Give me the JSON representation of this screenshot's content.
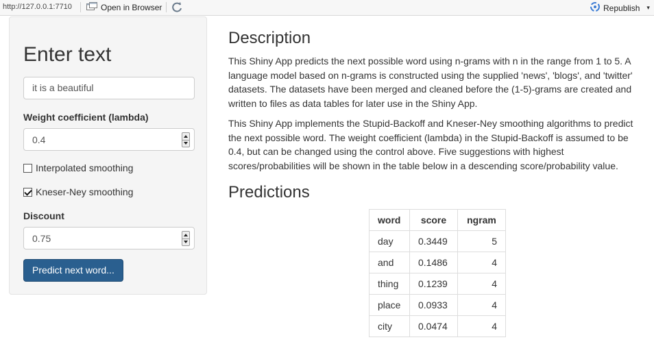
{
  "toolbar": {
    "url": "http://127.0.0.1:7710",
    "open_in_browser": "Open in Browser",
    "republish": "Republish"
  },
  "sidebar": {
    "title": "Enter text",
    "text_input_value": "it is a beautiful",
    "lambda_label": "Weight coefficient (lambda)",
    "lambda_value": "0.4",
    "interpolated_label": "Interpolated smoothing",
    "interpolated_checked": false,
    "kneser_label": "Kneser-Ney smoothing",
    "kneser_checked": true,
    "discount_label": "Discount",
    "discount_value": "0.75",
    "predict_button": "Predict next word..."
  },
  "main": {
    "description_heading": "Description",
    "description_p1": "This Shiny App predicts the next possible word using n-grams with n in the range from 1 to 5. A language model based on n-grams is constructed using the supplied 'news', 'blogs', and 'twitter' datasets. The datasets have been merged and cleaned before the (1-5)-grams are created and written to files as data tables for later use in the Shiny App.",
    "description_p2": "This Shiny App implements the Stupid-Backoff and Kneser-Ney smoothing algorithms to predict the next possible word. The weight coefficient (lambda) in the Stupid-Backoff is assumed to be 0.4, but can be changed using the control above. Five suggestions with highest scores/probabilities will be shown in the table below in a descending score/probability value.",
    "predictions_heading": "Predictions",
    "table": {
      "headers": [
        "word",
        "score",
        "ngram"
      ],
      "rows": [
        [
          "day",
          "0.3449",
          "5"
        ],
        [
          "and",
          "0.1486",
          "4"
        ],
        [
          "thing",
          "0.1239",
          "4"
        ],
        [
          "place",
          "0.0933",
          "4"
        ],
        [
          "city",
          "0.0474",
          "4"
        ]
      ]
    }
  }
}
